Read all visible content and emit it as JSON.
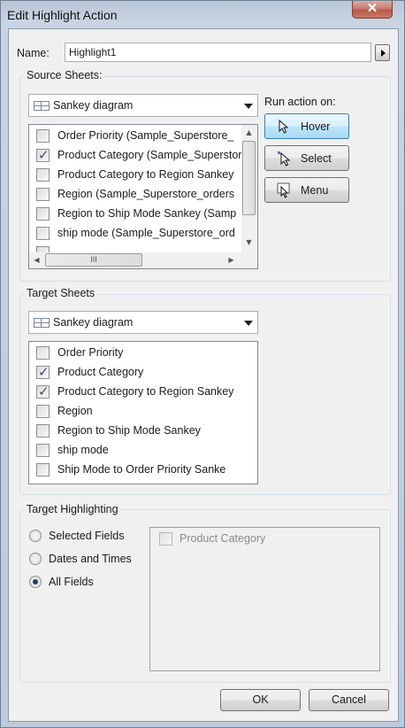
{
  "window": {
    "title": "Edit Highlight Action",
    "close_glyph": "✕"
  },
  "name_field": {
    "label": "Name:",
    "value": "Highlight1"
  },
  "source_sheets": {
    "title": "Source Sheets:",
    "selected_sheet": "Sankey diagram",
    "items": [
      {
        "label": "Order Priority (Sample_Superstore_",
        "checked": false
      },
      {
        "label": "Product Category (Sample_Superstore",
        "checked": true
      },
      {
        "label": "Product Category to Region Sankey",
        "checked": false
      },
      {
        "label": "Region (Sample_Superstore_orders",
        "checked": false
      },
      {
        "label": "Region to Ship Mode Sankey (Samp",
        "checked": false
      },
      {
        "label": "ship mode (Sample_Superstore_ord",
        "checked": false
      }
    ],
    "scrollbar": {
      "up": "▲",
      "down": "▼",
      "left": "◀",
      "right": "▶",
      "grip": "III"
    }
  },
  "run_action": {
    "label": "Run action on:",
    "options": [
      {
        "label": "Hover",
        "icon": "cursor-arrow-icon",
        "active": true
      },
      {
        "label": "Select",
        "icon": "cursor-select-icon",
        "active": false
      },
      {
        "label": "Menu",
        "icon": "cursor-menu-icon",
        "active": false
      }
    ]
  },
  "target_sheets": {
    "title": "Target Sheets",
    "selected_sheet": "Sankey diagram",
    "items": [
      {
        "label": "Order Priority",
        "checked": false
      },
      {
        "label": "Product Category",
        "checked": true
      },
      {
        "label": "Product Category to Region Sankey",
        "checked": true
      },
      {
        "label": "Region",
        "checked": false
      },
      {
        "label": "Region to Ship Mode Sankey",
        "checked": false
      },
      {
        "label": "ship mode",
        "checked": false
      },
      {
        "label": "Ship Mode to Order Priority Sanke",
        "checked": false
      }
    ]
  },
  "target_highlighting": {
    "title": "Target Highlighting",
    "options": [
      {
        "label": "Selected Fields",
        "selected": false
      },
      {
        "label": "Dates and Times",
        "selected": false
      },
      {
        "label": "All Fields",
        "selected": true
      }
    ],
    "fields": [
      {
        "label": "Product Category",
        "checked": false
      }
    ]
  },
  "buttons": {
    "ok": "OK",
    "cancel": "Cancel"
  }
}
